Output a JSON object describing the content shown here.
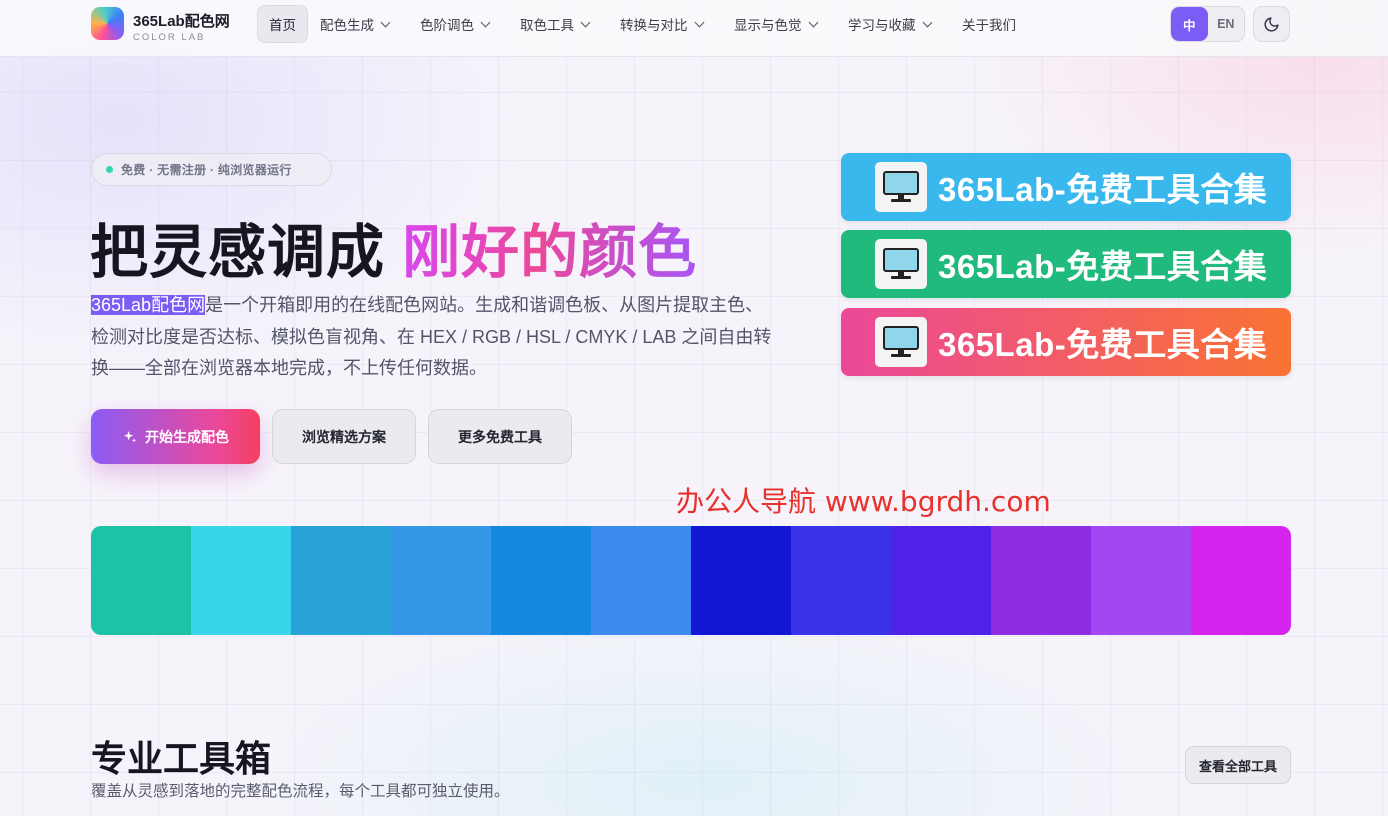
{
  "brand": {
    "title": "365Lab配色网",
    "subtitle": "COLOR LAB"
  },
  "nav": {
    "items": [
      {
        "label": "首页"
      },
      {
        "label": "配色生成"
      },
      {
        "label": "色阶调色"
      },
      {
        "label": "取色工具"
      },
      {
        "label": "转换与对比"
      },
      {
        "label": "显示与色觉"
      },
      {
        "label": "学习与收藏"
      },
      {
        "label": "关于我们"
      }
    ],
    "lang_zh": "中",
    "lang_en": "EN",
    "theme_icon": "moon-icon"
  },
  "hero": {
    "pill": "免费 · 无需注册 · 纯浏览器运行",
    "title_plain": "把灵感调成 ",
    "title_gradient": "刚好的颜色",
    "desc_highlight": "365Lab配色网",
    "desc_rest": "是一个开箱即用的在线配色网站。生成和谐调色板、从图片提取主色、检测对比度是否达标、模拟色盲视角、在 HEX / RGB / HSL / CMYK / LAB 之间自由转换——全部在浏览器本地完成，不上传任何数据。",
    "btn_primary": "开始生成配色",
    "btn_browse": "浏览精选方案",
    "btn_more": "更多免费工具"
  },
  "banners": [
    {
      "text": "365Lab-免费工具合集",
      "color": "#38b8ec"
    },
    {
      "text": "365Lab-免费工具合集",
      "color": "#1fba7c"
    },
    {
      "text": "365Lab-免费工具合集",
      "color": "#ec4899"
    }
  ],
  "watermark": "办公人导航 www.bgrdh.com",
  "palette": [
    "#1cc3a6",
    "#39d5e8",
    "#27a3d8",
    "#3597e8",
    "#138ae0",
    "#3b8aee",
    "#1117d2",
    "#3a32e6",
    "#4f22e8",
    "#8f2de4",
    "#a347f2",
    "#d424ee"
  ],
  "tools_section": {
    "title": "专业工具箱",
    "subtitle": "覆盖从灵感到落地的完整配色流程，每个工具都可独立使用。",
    "view_all": "查看全部工具"
  }
}
